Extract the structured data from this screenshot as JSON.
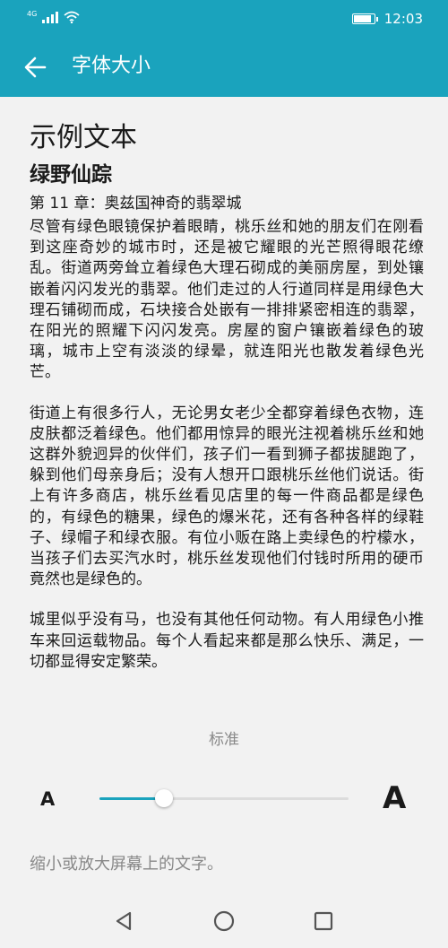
{
  "status_bar": {
    "network": "4G",
    "signal_icon": "signal-bars-icon",
    "wifi_icon": "wifi-icon",
    "battery_icon": "battery-icon",
    "battery_level": 0.9,
    "time": "12:03"
  },
  "app_bar": {
    "back_icon": "arrow-left-icon",
    "title": "字体大小"
  },
  "sample": {
    "heading": "示例文本",
    "book_title": "绿野仙踪",
    "chapter": "第 11 章：奥兹国神奇的翡翠城",
    "paragraphs": [
      "尽管有绿色眼镜保护着眼睛，桃乐丝和她的朋友们在刚看到这座奇妙的城市时，还是被它耀眼的光芒照得眼花缭乱。街道两旁耸立着绿色大理石砌成的美丽房屋，到处镶嵌着闪闪发光的翡翠。他们走过的人行道同样是用绿色大理石铺砌而成，石块接合处嵌有一排排紧密相连的翡翠，在阳光的照耀下闪闪发亮。房屋的窗户镶嵌着绿色的玻璃，城市上空有淡淡的绿晕，就连阳光也散发着绿色光芒。",
      "街道上有很多行人，无论男女老少全都穿着绿色衣物，连皮肤都泛着绿色。他们都用惊异的眼光注视着桃乐丝和她这群外貌迥异的伙伴们，孩子们一看到狮子都拔腿跑了，躲到他们母亲身后；没有人想开口跟桃乐丝他们说话。街上有许多商店，桃乐丝看见店里的每一件商品都是绿色的，有绿色的糖果，绿色的爆米花，还有各种各样的绿鞋子、绿帽子和绿衣服。有位小贩在路上卖绿色的柠檬水，当孩子们去买汽水时，桃乐丝发现他们付钱时所用的硬币竟然也是绿色的。",
      "城里似乎没有马，也没有其他任何动物。有人用绿色小推车来回运载物品。每个人看起来都是那么快乐、满足，一切都显得安定繁荣。"
    ]
  },
  "font_size": {
    "current_label": "标准",
    "small_label": "A",
    "large_label": "A",
    "slider_fraction": 0.26,
    "description": "缩小或放大屏幕上的文字。"
  },
  "nav_bar": {
    "back_icon": "triangle-back-icon",
    "home_icon": "circle-home-icon",
    "recent_icon": "square-recents-icon"
  },
  "colors": {
    "accent": "#1aa3bd",
    "background": "#f2f2f2",
    "muted_text": "#888888"
  }
}
